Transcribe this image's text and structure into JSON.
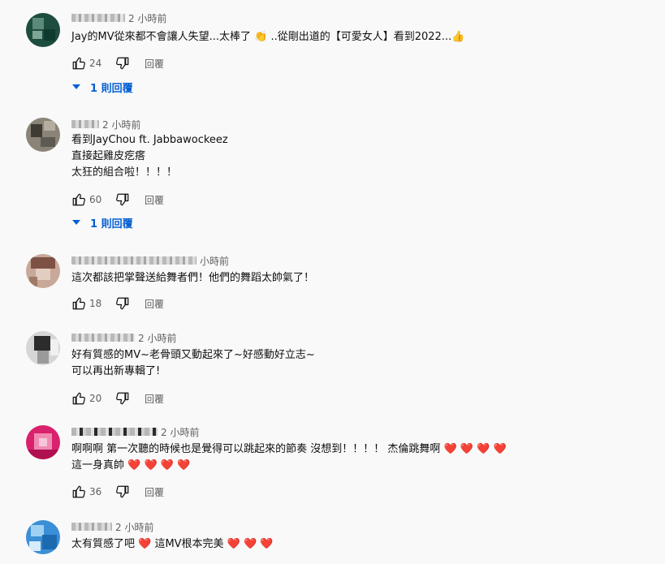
{
  "comments": [
    {
      "time": "2 小時前",
      "lines": [
        "Jay的MV從來都不會讓人失望...太棒了 👏 ..從剛出道的【可愛女人】看到2022...👍"
      ],
      "likes": "24",
      "reply_label": "回覆",
      "replies_label": "1 則回覆",
      "avatar_colors": [
        "#1d4d3f",
        "#5c8a7a",
        "#0f3a2e",
        "#7fa597"
      ]
    },
    {
      "time": "2 小時前",
      "lines": [
        "看到JayChou ft. Jabbawockeez",
        "直接起雞皮疙瘩",
        "太狂的組合啦！！！！"
      ],
      "likes": "60",
      "reply_label": "回覆",
      "replies_label": "1 則回覆",
      "avatar_colors": [
        "#8a8478",
        "#3e3b35",
        "#b5ad9d",
        "#5d5a52"
      ]
    },
    {
      "time": "小時前",
      "lines": [
        "這次都該把掌聲送給舞者們！他們的舞蹈太帥氣了！"
      ],
      "likes": "18",
      "reply_label": "回覆",
      "avatar_colors": [
        "#c8a898",
        "#7d5244",
        "#e2cdc1",
        "#a07a68"
      ]
    },
    {
      "time": "2 小時前",
      "lines": [
        "好有質感的MV~老骨頭又動起來了~好感動好立志~",
        "可以再出新專輯了!"
      ],
      "likes": "20",
      "reply_label": "回覆",
      "avatar_colors": [
        "#d6d6d6",
        "#2c2c2c",
        "#9a9a9a",
        "#f0f0f0"
      ]
    },
    {
      "time": "2 小時前",
      "lines": [
        "啊啊啊 第一次聽的時候也是覺得可以跳起來的節奏 沒想到！！！！ 杰倫跳舞啊 ❤️ ❤️ ❤️ ❤️",
        "這一身真帥 ❤️ ❤️ ❤️ ❤️"
      ],
      "likes": "36",
      "reply_label": "回覆",
      "avatar_colors": [
        "#d9216d",
        "#f08ab2",
        "#b0104f",
        "#f7c6da"
      ]
    },
    {
      "time": "2 小時前",
      "lines": [
        "太有質感了吧 ❤️ 這MV根本完美 ❤️ ❤️ ❤️"
      ],
      "avatar_colors": [
        "#3b8fd6",
        "#9fd0f2",
        "#1c6bb0",
        "#d7ecfa"
      ]
    }
  ],
  "icons": {
    "like": "thumbs-up-icon",
    "dislike": "thumbs-down-icon",
    "expand": "caret-down-icon"
  },
  "colors": {
    "link_blue": "#065fd4",
    "meta_gray": "#606060",
    "heart_red": "#e02020",
    "background": "#f9f9f9"
  }
}
